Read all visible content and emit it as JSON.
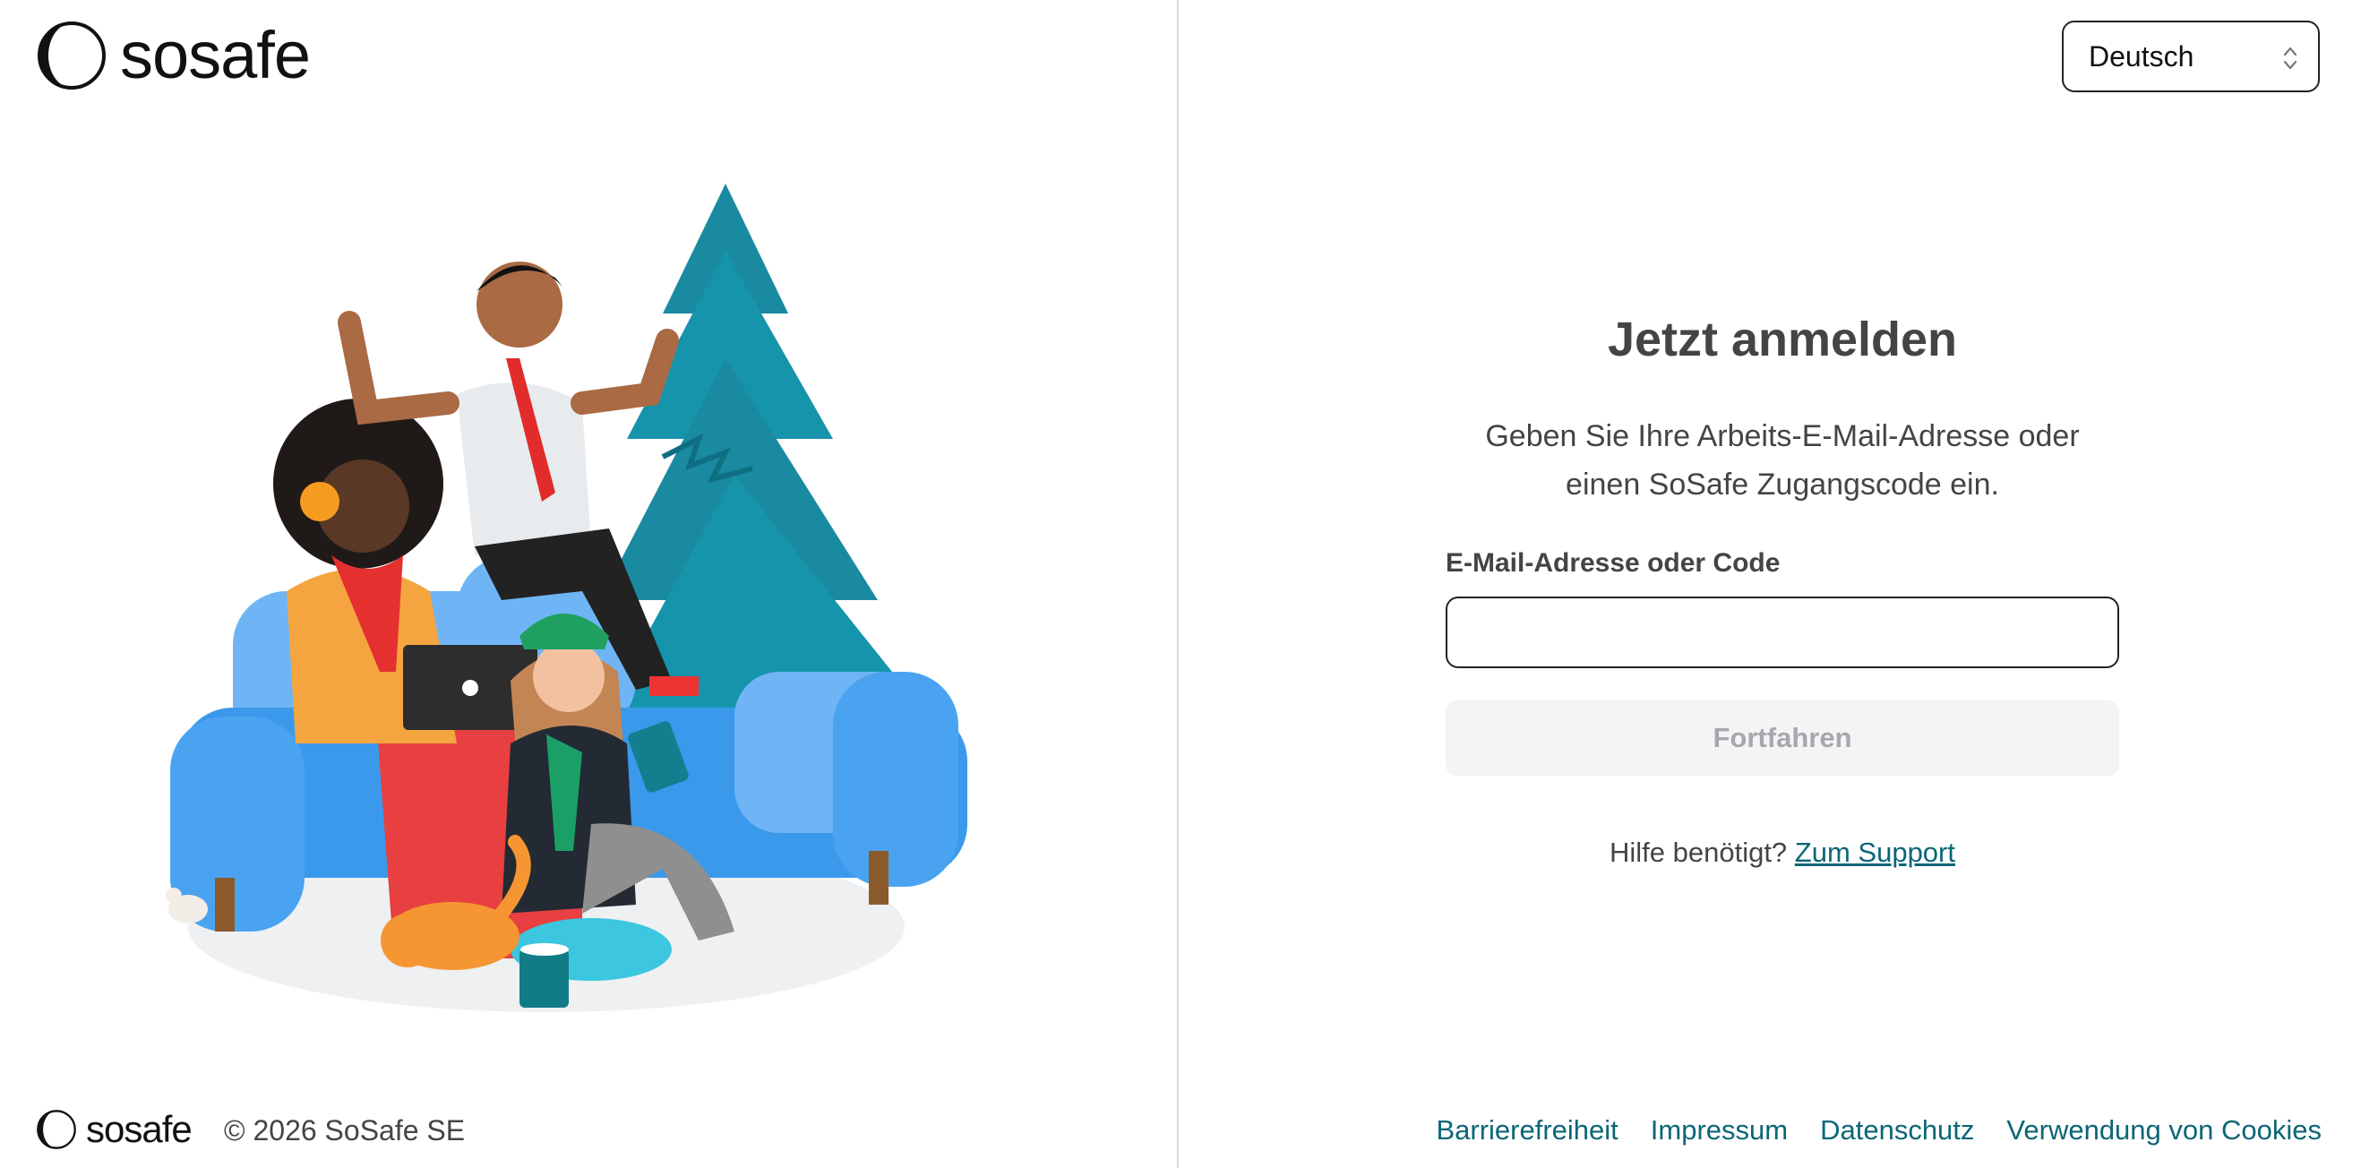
{
  "brand": {
    "name": "sosafe",
    "footer_name": "sosafe",
    "copyright": "© 2026 SoSafe SE"
  },
  "language_select": {
    "value": "Deutsch",
    "icon": "chevron-up-down-icon"
  },
  "login": {
    "title": "Jetzt anmelden",
    "description_line1": "Geben Sie Ihre Arbeits-E-Mail-Adresse oder",
    "description_line2": "einen SoSafe Zugangscode ein.",
    "field_label": "E-Mail-Adresse oder Code",
    "field_value": "",
    "continue_label": "Fortfahren",
    "help_text": "Hilfe benötigt?",
    "support_link": "Zum Support"
  },
  "footer": {
    "links": [
      "Barrierefreiheit",
      "Impressum",
      "Datenschutz",
      "Verwendung von Cookies"
    ]
  },
  "colors": {
    "link": "#0b6677",
    "button_disabled_bg": "#f3f4f5",
    "button_disabled_text": "#a6a8ab",
    "heading": "#444444"
  }
}
